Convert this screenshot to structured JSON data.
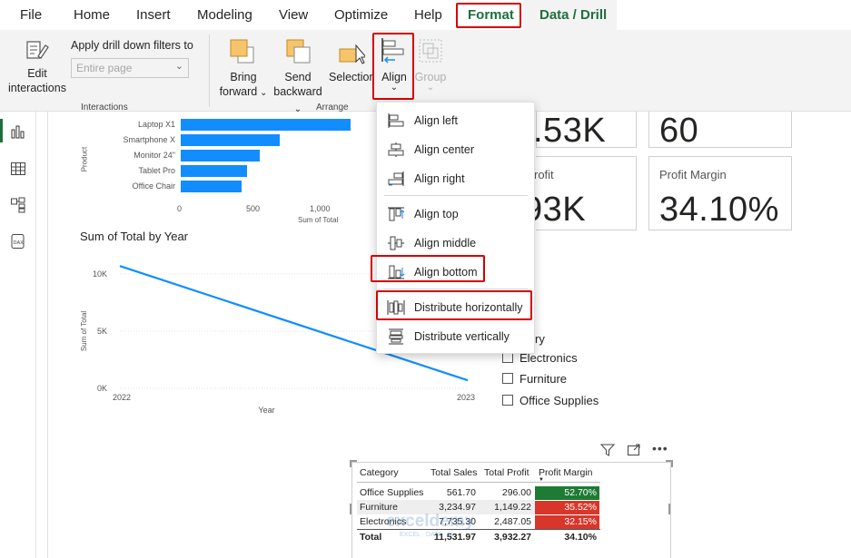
{
  "menu": {
    "file": "File",
    "home": "Home",
    "insert": "Insert",
    "modeling": "Modeling",
    "view": "View",
    "optimize": "Optimize",
    "help": "Help",
    "format": "Format",
    "data_drill": "Data / Drill"
  },
  "ribbon": {
    "edit_interactions_1": "Edit",
    "edit_interactions_2": "interactions",
    "apply_drill": "Apply drill down filters to",
    "apply_drill_value": "Entire page",
    "bring_forward_1": "Bring",
    "bring_forward_2": "forward",
    "send_backward_1": "Send",
    "send_backward_2": "backward",
    "selection": "Selection",
    "align": "Align",
    "group": "Group",
    "group_interactions": "Interactions",
    "group_arrange": "Arrange"
  },
  "align_menu": {
    "items": [
      "Align left",
      "Align center",
      "Align right",
      "Align top",
      "Align middle",
      "Align bottom",
      "Distribute horizontally",
      "Distribute vertically"
    ]
  },
  "bar_chart": {
    "ylabel": "Product",
    "xlabel": "Sum of Total",
    "ticks": [
      "0",
      "500",
      "1,000"
    ]
  },
  "line_chart": {
    "title": "Sum of Total by Year",
    "ylabel": "Sum of Total",
    "xlabel": "Year",
    "yticks": [
      "10K",
      "5K",
      "0K"
    ],
    "xticks": [
      "2022",
      "2023"
    ]
  },
  "chart_data": [
    {
      "type": "bar",
      "categories": [
        "Laptop X1",
        "Smartphone X",
        "Monitor 24\"",
        "Tablet Pro",
        "Office Chair"
      ],
      "values": [
        1230,
        720,
        570,
        480,
        440
      ],
      "xlabel": "Sum of Total",
      "ylabel": "Product",
      "xlim": [
        0,
        1300
      ]
    },
    {
      "type": "line",
      "title": "Sum of Total by Year",
      "x": [
        "2022",
        "2023"
      ],
      "values": [
        10700,
        700
      ],
      "xlabel": "Year",
      "ylabel": "Sum of Total",
      "ylim": [
        0,
        12000
      ]
    }
  ],
  "cards": {
    "c1_value": ".53K",
    "c2_value": "60",
    "c3_label": "rofit",
    "c3_value": "93K",
    "c4_label": "Profit Margin",
    "c4_value": "34.10%"
  },
  "slicer": {
    "header_fragment": "ry",
    "items": [
      "Electronics",
      "Furniture",
      "Office Supplies"
    ]
  },
  "table": {
    "headers": [
      "Category",
      "Total Sales",
      "Total Profit",
      "Profit Margin"
    ],
    "rows": [
      [
        "Office Supplies",
        "561.70",
        "296.00",
        "52.70%"
      ],
      [
        "Furniture",
        "3,234.97",
        "1,149.22",
        "35.52%"
      ],
      [
        "Electronics",
        "7,735.30",
        "2,487.05",
        "32.15%"
      ]
    ],
    "total": [
      "Total",
      "11,531.97",
      "3,932.27",
      "34.10%"
    ],
    "pm_colors": [
      "#1e7b34",
      "#d9362b",
      "#d9362b"
    ]
  },
  "watermark": "exceldemy",
  "watermark_sub": "EXCEL · DATA · BI",
  "colors": {
    "accent": "#1e6f3e",
    "highlight": "#d60000",
    "bar": "#118dff"
  }
}
